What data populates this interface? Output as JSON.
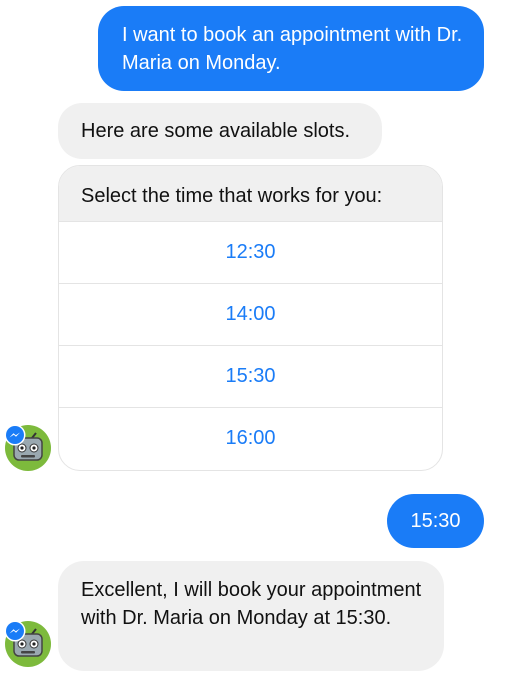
{
  "conversation": {
    "messages": [
      {
        "sender": "user",
        "text": "I want to book an appointment with Dr. Maria on Monday."
      },
      {
        "sender": "bot",
        "text": "Here are some available slots."
      }
    ],
    "quick_reply": {
      "prompt": "Select the time that works for you:",
      "options": [
        "12:30",
        "14:00",
        "15:30",
        "16:00"
      ]
    },
    "reply": {
      "sender": "user",
      "text": "15:30"
    },
    "confirmation": {
      "sender": "bot",
      "text": "Excellent, I will book your appointment with Dr. Maria on Monday at 15:30."
    }
  },
  "colors": {
    "user_bubble": "#1a7cf7",
    "bot_bubble": "#f0f0f0",
    "option_text": "#1a7cf7",
    "avatar_bg": "#7dba3c"
  },
  "icons": {
    "bot_avatar": "robot-icon",
    "platform_badge": "messenger-icon"
  }
}
